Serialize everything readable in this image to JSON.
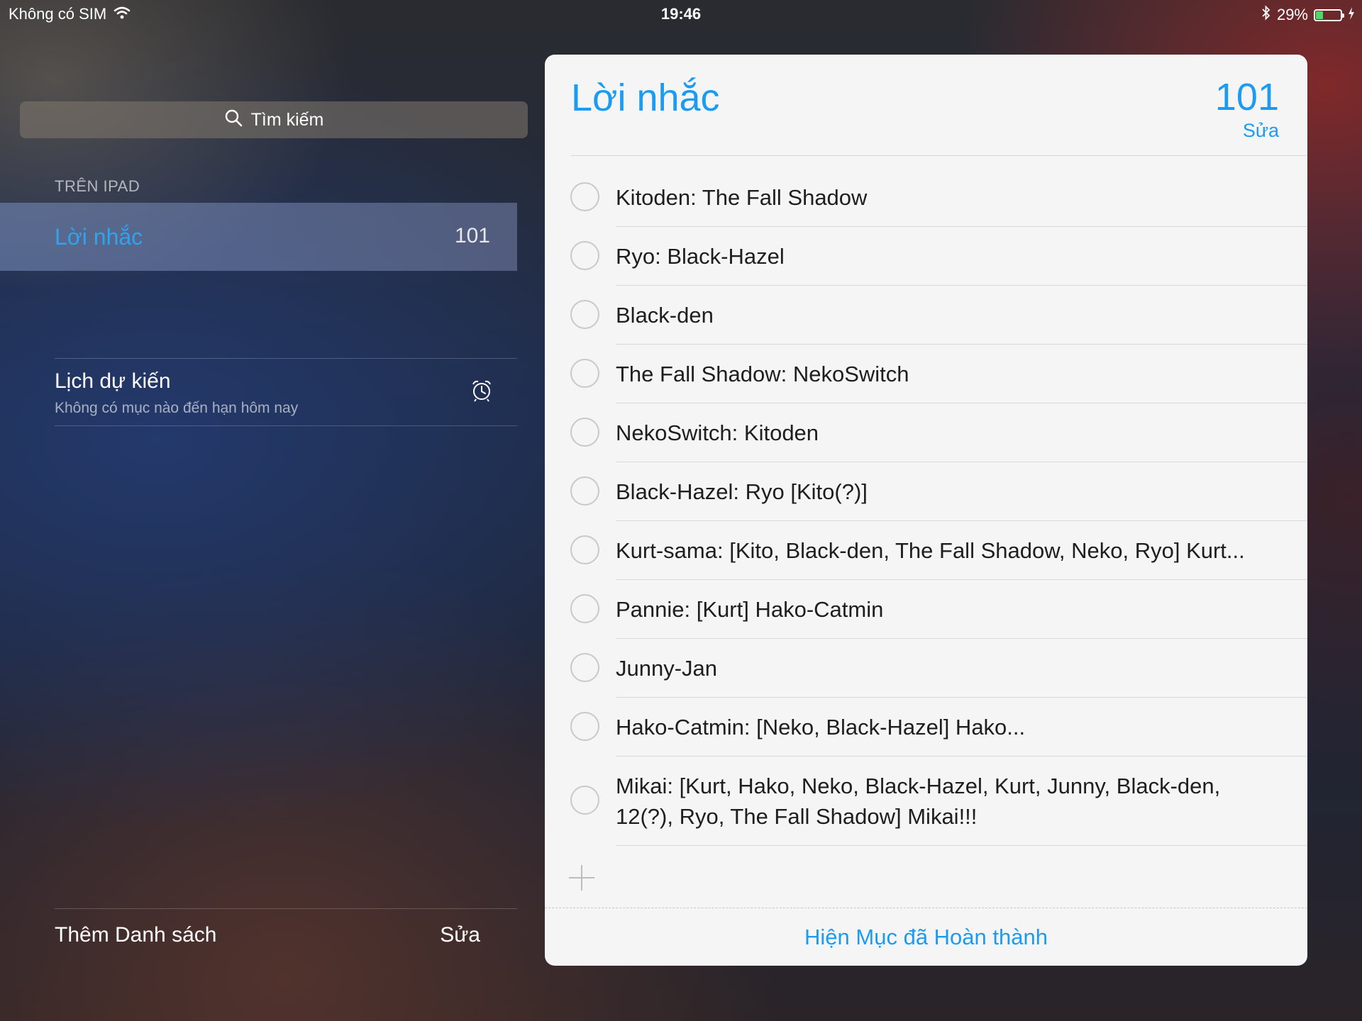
{
  "status_bar": {
    "carrier": "Không có SIM",
    "time": "19:46",
    "battery_percent": "29%",
    "battery_level": 0.29,
    "icons": [
      "wifi-icon",
      "bluetooth-icon",
      "battery-icon",
      "charging-bolt-icon"
    ]
  },
  "sidebar": {
    "search_placeholder": "Tìm kiếm",
    "section_header": "TRÊN IPAD",
    "lists": [
      {
        "name": "Lời nhắc",
        "count": "101",
        "selected": true
      }
    ],
    "scheduled": {
      "title": "Lịch dự kiến",
      "subtitle": "Không có mục nào đến hạn hôm nay",
      "icon": "alarm-clock-icon"
    },
    "footer": {
      "add_list_label": "Thêm Danh sách",
      "edit_label": "Sửa"
    }
  },
  "main": {
    "title": "Lời nhắc",
    "count": "101",
    "edit_label": "Sửa",
    "accent_color": "#1b9cf2",
    "items": [
      {
        "text": "Kitoden: The Fall Shadow"
      },
      {
        "text": "Ryo: Black-Hazel"
      },
      {
        "text": "Black-den"
      },
      {
        "text": "The Fall Shadow: NekoSwitch"
      },
      {
        "text": "NekoSwitch: Kitoden"
      },
      {
        "text": "Black-Hazel: Ryo [Kito(?)]"
      },
      {
        "text": "Kurt-sama: [Kito, Black-den, The Fall Shadow, Neko, Ryo] Kurt..."
      },
      {
        "text": "Pannie: [Kurt] Hako-Catmin"
      },
      {
        "text": "Junny-Jan"
      },
      {
        "text": "Hako-Catmin: [Neko, Black-Hazel] Hako..."
      },
      {
        "text": "Mikai: [Kurt, Hako, Neko, Black-Hazel, Kurt, Junny, Black-den, 12(?), Ryo, The Fall Shadow] Mikai!!!"
      }
    ],
    "add_icon": "plus-icon",
    "show_completed_label": "Hiện Mục đã Hoàn thành"
  }
}
